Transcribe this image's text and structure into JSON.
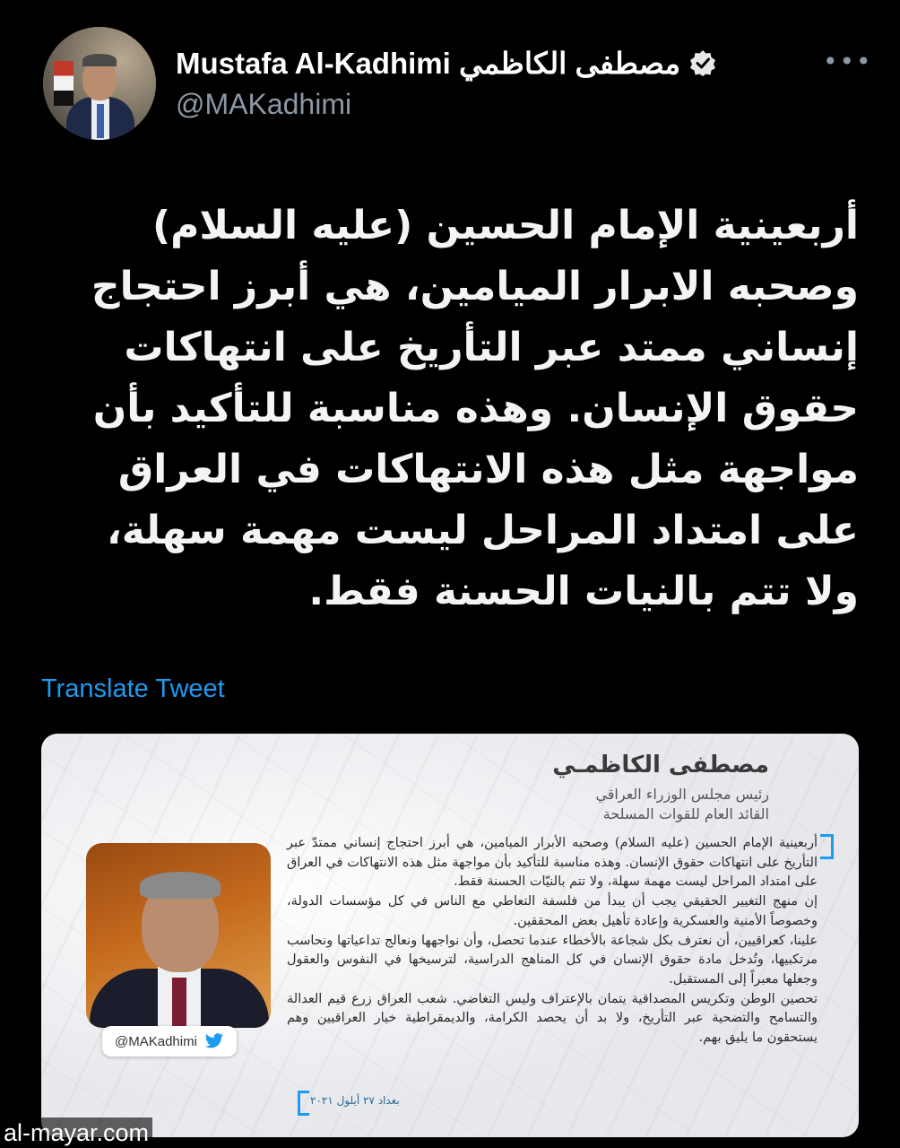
{
  "author": {
    "display_name": "Mustafa Al-Kadhimi مصطفى الكاظمي",
    "handle": "@MAKadhimi",
    "verified": true
  },
  "icons": {
    "verified": "verified-badge-icon",
    "more": "more-options-icon",
    "twitter": "twitter-bird-icon"
  },
  "tweet": {
    "text": "أربعينية الإمام الحسين (عليه السلام) وصحبه الابرار الميامين، هي أبرز احتجاج إنساني ممتد عبر التأريخ على انتهاكات حقوق الإنسان. وهذه مناسبة للتأكيد بأن مواجهة مثل هذه الانتهاكات في العراق على امتداد المراحل ليست مهمة سهلة، ولا تتم بالنيات الحسنة فقط.",
    "translate_label": "Translate Tweet"
  },
  "media_card": {
    "name": "مصطفى الكاظمـي",
    "title_line1": "رئيس مجلس الوزراء العراقي",
    "title_line2": "القائد العام للقوات المسلحة",
    "handle_chip": "@MAKadhimi",
    "paragraphs": [
      "أربعينية الإمام الحسين (عليه السلام) وصحبه الأبرار الميامين، هي أبرز احتجاج إنساني ممتدّ عبر التأريخ على انتهاكات حقوق الإنسان. وهذه مناسبة للتأكيد بأن مواجهة مثل هذه الانتهاكات في العراق على امتداد المراحل ليست مهمة سهلة، ولا تتم بالنيّات الحسنة فقط.",
      "إن منهج التغيير الحقيقي يجب أن يبدأ من فلسفة التعاطي مع الناس في كل مؤسسات الدولة، وخصوصاً الأمنية والعسكرية وإعادة تأهيل بعض المحققين.",
      "علينا، كعراقيين، أن نعترف بكل شجاعة بالأخطاء عندما تحصل، وأن نواجهها ونعالج تداعياتها ونحاسب مرتكبيها، وتُدخل مادة حقوق الإنسان في كل المناهج الدراسية، لترسيخها في النفوس والعقول وجعلها معبراً إلى المستقبل.",
      "تحصين الوطن وتكريس المصداقية يتمان بالإعتراف وليس التغاضي. شعب العراق زرع قيم العدالة والتسامح والتضحية عبر التأريخ، ولا بد أن يحصد الكرامة، والديمقراطية خيار العراقيين وهم يستحقون ما يليق بهم."
    ],
    "date": "بغداد ٢٧ أيلول ٢٠٢١"
  },
  "watermark": "al-mayar.com",
  "colors": {
    "background": "#000000",
    "link": "#1d9bf0",
    "secondary_text": "#8b98a5"
  }
}
